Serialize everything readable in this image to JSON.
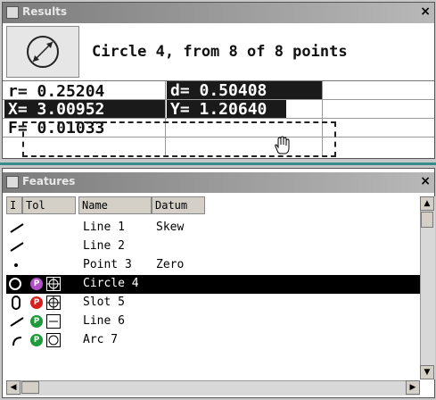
{
  "results": {
    "title": "Results",
    "close": "×",
    "headline": "Circle 4, from 8 of 8 points",
    "cells": {
      "r": "r= 0.25204",
      "d": "d= 0.50408",
      "x": "X= 3.00952",
      "y": "Y= 1.20640",
      "f": "F= 0.01033"
    }
  },
  "features": {
    "title": "Features",
    "close": "×",
    "columns": [
      "I",
      "Tol",
      "Name",
      "Datum"
    ],
    "rows": [
      {
        "name": "Line 1",
        "datum": "Skew",
        "icon": "line-icon"
      },
      {
        "name": "Line 2",
        "datum": "",
        "icon": "line-icon"
      },
      {
        "name": "Point 3",
        "datum": "Zero",
        "icon": "point-icon"
      },
      {
        "name": "Circle 4",
        "datum": "",
        "icon": "circle-icon",
        "tol": "P",
        "tol_color": "#b04fc7"
      },
      {
        "name": "Slot 5",
        "datum": "",
        "icon": "slot-icon",
        "tol": "P",
        "tol_color": "#d81f1f"
      },
      {
        "name": "Line 6",
        "datum": "",
        "icon": "line-icon",
        "tol": "P",
        "tol_color": "#1d9a3a"
      },
      {
        "name": "Arc 7",
        "datum": "",
        "icon": "arc-icon",
        "tol": "P",
        "tol_color": "#1d9a3a"
      }
    ]
  }
}
